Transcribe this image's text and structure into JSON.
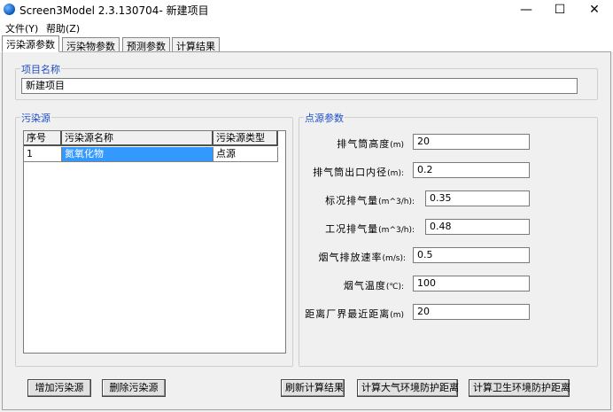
{
  "window": {
    "title": "Screen3Model 2.3.130704- 新建项目",
    "controls": {
      "minimize": "—",
      "maximize": "☐",
      "close": "✕"
    }
  },
  "menu": {
    "items": [
      {
        "label": "文件(Y)"
      },
      {
        "label": "帮助(Z)"
      }
    ]
  },
  "tabs": [
    {
      "label": "污染源参数",
      "active": true
    },
    {
      "label": "污染物参数",
      "active": false
    },
    {
      "label": "预测参数",
      "active": false
    },
    {
      "label": "计算结果",
      "active": false
    }
  ],
  "project": {
    "group_title": "项目名称",
    "name_value": "新建项目"
  },
  "sources": {
    "group_title": "污染源",
    "columns": [
      "序号",
      "污染源名称",
      "污染源类型"
    ],
    "rows": [
      {
        "index": "1",
        "name": "氮氧化物",
        "type": "点源"
      }
    ]
  },
  "point_params": {
    "group_title": "点源参数",
    "rows": [
      {
        "label": "排气筒高度",
        "unit": "(m)",
        "value": "20"
      },
      {
        "label": "排气筒出口内径",
        "unit": "(m):",
        "value": "0.2"
      },
      {
        "label": "标况排气量",
        "unit": "(m^3/h):",
        "value": "0.35"
      },
      {
        "label": "工况排气量",
        "unit": "(m^3/h):",
        "value": "0.48"
      },
      {
        "label": "烟气排放速率",
        "unit": "(m/s):",
        "value": "0.5"
      },
      {
        "label": "烟气温度",
        "unit": "(℃):",
        "value": "100"
      },
      {
        "label": "距离厂界最近距离",
        "unit": "(m)",
        "value": "20"
      }
    ]
  },
  "buttons": {
    "add_source": "增加污染源",
    "delete_source": "删除污染源",
    "refresh_results": "刷新计算结果",
    "calc_atmospheric_distance": "计算大气环境防护距离",
    "calc_sanitary_distance": "计算卫生环境防护距离"
  }
}
